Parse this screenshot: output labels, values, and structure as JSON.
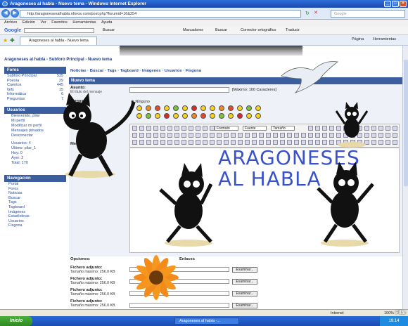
{
  "window": {
    "title": "Aragoneses al habla - Nuevo tema - Windows Internet Explorer",
    "url": "http://aragonesesalhabla.nforos.com/post.php?forumid=16&254",
    "search_placeholder": "Google"
  },
  "menu": [
    "Archivo",
    "Edición",
    "Ver",
    "Favoritos",
    "Herramientas",
    "Ayuda"
  ],
  "gbar": {
    "google": "Google",
    "buscar": "Buscar",
    "marcadores": "Marcadores",
    "buscar2": "Buscar",
    "corrector": "Corrector ortográfico",
    "traducir": "Traducir"
  },
  "tab": {
    "label": "Aragoneses al habla - Nuevo tema",
    "pagina": "Página",
    "herramientas": "Herramientas"
  },
  "breadcrumb": "Aragoneses al habla - Subforo Principal - Nuevo tema",
  "foros": {
    "title": "Foros",
    "items": [
      {
        "name": "Subforo Principal",
        "count": "535"
      },
      {
        "name": "Poesía",
        "count": "29"
      },
      {
        "name": "Cuentos",
        "count": "445"
      },
      {
        "name": "Gifs",
        "count": "15"
      },
      {
        "name": "Informática",
        "count": "6"
      },
      {
        "name": "Preguntas",
        "count": "7"
      }
    ]
  },
  "usuarios": {
    "title": "Usuarios",
    "items": [
      "Bienvenido, pilar",
      "Mi perfil",
      "Modificar mi perfil",
      "Mensajes privados",
      "Desconectar"
    ],
    "stats": [
      "Usuarios: 4",
      "Último: pilar_1",
      "Hoy: 0",
      "Ayer: 2",
      "Total: 170"
    ]
  },
  "navegacion": {
    "title": "Navegación",
    "items": [
      "Portal",
      "Foros",
      "Noticias",
      "Buscar",
      "Tags",
      "Tagboard",
      "Imágenes",
      "Estadísticas",
      "Usuarios",
      "Fisgona"
    ]
  },
  "toplinks": "Noticias · Buscar · Tags · Tagboard · Imágenes · Usuarios · Fisgona",
  "form": {
    "header": "Nuevo tema",
    "asunto": "Asunto:",
    "asunto_sub": "El título del mensaje",
    "max": "[Máximo: 100 Caracteres]",
    "iconos": "Iconos:",
    "ninguno": "Ninguno",
    "formato": "Formato",
    "fuente": "Fuente",
    "tamano": "Tamaño",
    "mensaje": "Mensaje:",
    "opciones": "Opciones:",
    "enlaces": "Enlaces"
  },
  "logo": {
    "line1": "ARAGONESES",
    "line2": "AL HABLA"
  },
  "files": [
    {
      "label": "Fichero adjunto:",
      "size": "Tamaño máximo: 256.0 KB",
      "button": "Examinar..."
    },
    {
      "label": "Fichero adjunto:",
      "size": "Tamaño máximo: 256.0 KB",
      "button": "Examinar..."
    },
    {
      "label": "Fichero adjunto:",
      "size": "Tamaño máximo: 256.0 KB",
      "button": "Examinar..."
    },
    {
      "label": "Fichero adjunto:",
      "size": "Tamaño máximo: 256.0 KB",
      "button": "Examinar..."
    }
  ],
  "status": {
    "internet": "Internet",
    "zoom": "100%"
  },
  "taskbar": {
    "start": "Inicio",
    "item": "Aragoneses al habla -...",
    "clock": "19:14"
  },
  "watermark": "Pilar"
}
